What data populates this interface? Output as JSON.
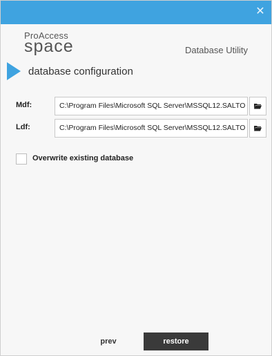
{
  "window": {
    "close_glyph": "✕"
  },
  "header": {
    "logo_top": "ProAccess",
    "logo_bottom": "space",
    "app_name": "Database Utility"
  },
  "step": {
    "title": "database configuration"
  },
  "fields": {
    "mdf": {
      "label": "Mdf:",
      "value": "C:\\Program Files\\Microsoft SQL Server\\MSSQL12.SALTO"
    },
    "ldf": {
      "label": "Ldf:",
      "value": "C:\\Program Files\\Microsoft SQL Server\\MSSQL12.SALTO"
    }
  },
  "options": {
    "overwrite_label": "Overwrite existing database",
    "overwrite_checked": false
  },
  "footer": {
    "prev_label": "prev",
    "restore_label": "restore"
  },
  "colors": {
    "accent": "#3fa3e0",
    "dark_button": "#3a3a3a"
  },
  "icons": {
    "close": "close-icon",
    "browse": "folder-icon"
  }
}
